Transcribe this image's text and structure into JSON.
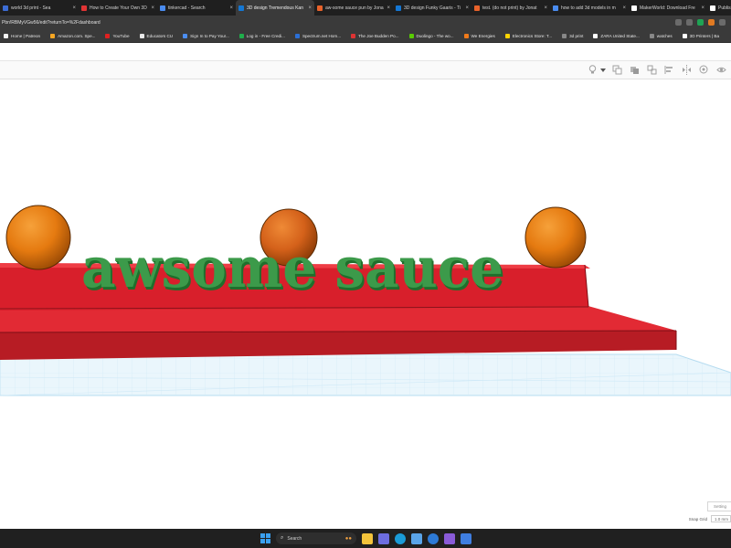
{
  "tabs": [
    {
      "label": "world 3d print - Sea",
      "color": "#3c6cd4",
      "close": "×"
    },
    {
      "label": "How to Create Your Own 3D",
      "color": "#e03434",
      "close": "×"
    },
    {
      "label": "tinkercad - Search",
      "color": "#4a8cf0",
      "close": "×"
    },
    {
      "label": "3D design Tremendous Kan",
      "color": "#1477d4",
      "close": "×"
    },
    {
      "label": "aw-some sauce pun by Jona",
      "color": "#e8622a",
      "close": "×"
    },
    {
      "label": "3D design Funky Gaaris - Ti",
      "color": "#1477d4",
      "close": "×"
    },
    {
      "label": "test. (do not print) by Jonat",
      "color": "#e8622a",
      "close": "×"
    },
    {
      "label": "how to add 3d models in m",
      "color": "#4a8cf0",
      "close": "×"
    },
    {
      "label": "MakerWorld: Download Fre",
      "color": "#ffffff",
      "close": "×"
    },
    {
      "label": "Publish Mode",
      "color": "#ffffff",
      "close": ""
    }
  ],
  "active_tab_index": 3,
  "address": {
    "url": "Pbn!RBMyVGw56/edit?returnTo=%2Fdashboard"
  },
  "bookmarks": [
    {
      "label": "Home | Patreon",
      "color": "#f4f4f4"
    },
    {
      "label": "Amazon.com. Spe...",
      "color": "#f5a623"
    },
    {
      "label": "YouTube",
      "color": "#e02020"
    },
    {
      "label": "Educators CU",
      "color": "#e8e8e8"
    },
    {
      "label": "Sign In to Pay Your...",
      "color": "#4c8ef0"
    },
    {
      "label": "Log in - Free Credi...",
      "color": "#1fae4b"
    },
    {
      "label": "Spectrum.net Hom...",
      "color": "#2b6fd6"
    },
    {
      "label": "The Joe Budden Po...",
      "color": "#d33"
    },
    {
      "label": "Duolingo - The wo...",
      "color": "#58cc02"
    },
    {
      "label": "We Energies",
      "color": "#f07a1a"
    },
    {
      "label": "Electronics Store: T...",
      "color": "#ffd400"
    },
    {
      "label": "3d print",
      "color": "#888888"
    },
    {
      "label": "ZARA United State...",
      "color": "#ffffff"
    },
    {
      "label": "watches",
      "color": "#888888"
    },
    {
      "label": "3D Printers | Ba",
      "color": "#ffffff"
    }
  ],
  "toolbar": {
    "icons": [
      "lightbulb-icon",
      "copy-icon",
      "group-icon",
      "ungroup-icon",
      "align-icon",
      "mirror-icon",
      "cruise-icon",
      "hide-icon"
    ]
  },
  "scene": {
    "text": "awsome sauce",
    "colors": {
      "text": "#3c9a4a",
      "base": "#e4202e",
      "balls": "#e57a10",
      "grid": "#dff1fb"
    }
  },
  "settings": {
    "label": "Setting"
  },
  "snap": {
    "label": "Snap Grid",
    "value": "1.0 mm"
  },
  "taskbar": {
    "search_placeholder": "Search",
    "icons": [
      "windows-icon",
      "search-icon",
      "widgets-icon",
      "files-icon",
      "photos-icon",
      "edge-icon",
      "vpn-icon",
      "chrome-icon",
      "media-icon",
      "store-icon"
    ]
  }
}
